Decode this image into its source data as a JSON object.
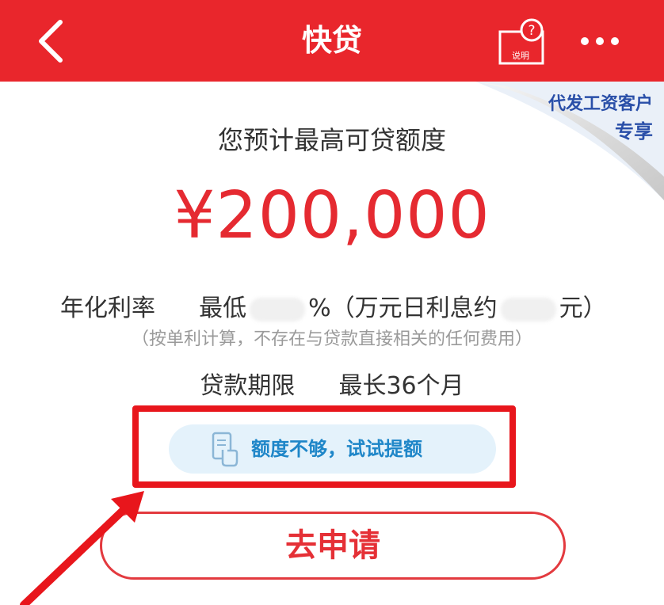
{
  "header": {
    "title": "快贷",
    "back_icon": "chevron-left-icon",
    "help_icon": "help-document-icon",
    "help_icon_label": "说明",
    "more_icon": "more-dots-icon"
  },
  "corner_badge": {
    "line1": "代发工资客户",
    "line2": "专享"
  },
  "loan": {
    "label": "您预计最高可贷额度",
    "amount": "¥200,000",
    "rate_label": "年化利率",
    "rate_min": "最低",
    "rate_unit": "%",
    "rate_daily_prefix": "（万元日利息约",
    "rate_daily_suffix": "元）",
    "note": "（按单利计算，不存在与贷款直接相关的任何费用）",
    "term_label": "贷款期限",
    "term_value": "最长36个月"
  },
  "actions": {
    "increase_limit": "额度不够，试试提额",
    "apply": "去申请"
  },
  "colors": {
    "brand_red": "#e9262c",
    "amount_red": "#e52a31",
    "pill_blue": "#1e86c8",
    "pill_bg": "#e4f2fb",
    "corner_blue": "#2a4fa8"
  }
}
